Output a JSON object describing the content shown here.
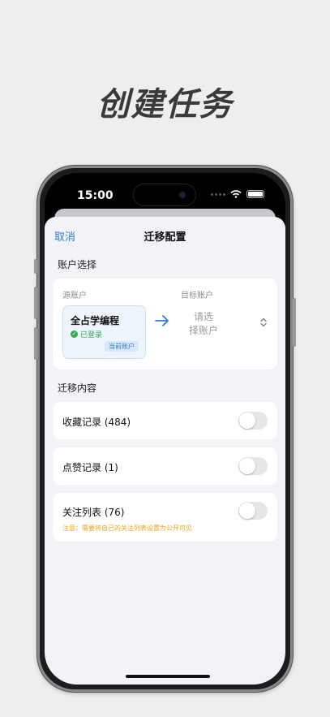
{
  "headline": "创建任务",
  "status_bar": {
    "time": "15:00"
  },
  "nav": {
    "cancel": "取消",
    "title": "迁移配置"
  },
  "account_section": {
    "label": "账户选择",
    "source_label": "源账户",
    "target_label": "目标账户",
    "source_name": "全占学编程",
    "source_status": "已登录",
    "current_tag": "当前账户",
    "target_placeholder_line1": "请选",
    "target_placeholder_line2": "择账户"
  },
  "content_section": {
    "label": "迁移内容",
    "items": [
      {
        "label": "收藏记录 (484)",
        "enabled": false
      },
      {
        "label": "点赞记录 (1)",
        "enabled": false
      },
      {
        "label": "关注列表 (76)",
        "enabled": false
      }
    ],
    "follow_note": "注意：需要将自己的关注列表设置为公开可见"
  },
  "colors": {
    "accent": "#2f7fd0",
    "success": "#34a853",
    "warning": "#e8a317"
  }
}
